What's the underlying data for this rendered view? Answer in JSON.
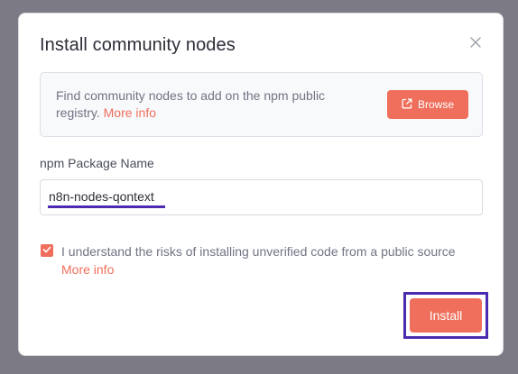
{
  "dialog": {
    "title": "Install community nodes",
    "info": {
      "text": "Find community nodes to add on the npm public registry.",
      "link": "More info",
      "browse_label": "Browse"
    },
    "package_field": {
      "label": "npm Package Name",
      "value": "n8n-nodes-qontext"
    },
    "risk_checkbox": {
      "checked": true,
      "label": "I understand the risks of installing unverified code from a public source",
      "link": "More info"
    },
    "install_label": "Install"
  },
  "colors": {
    "overlay": "#7c7b85",
    "accent": "#ef6f5c",
    "highlight": "#4b2bb0"
  },
  "icons": {
    "close": "close-icon",
    "browse": "external-link-icon",
    "check": "checkmark-icon"
  }
}
